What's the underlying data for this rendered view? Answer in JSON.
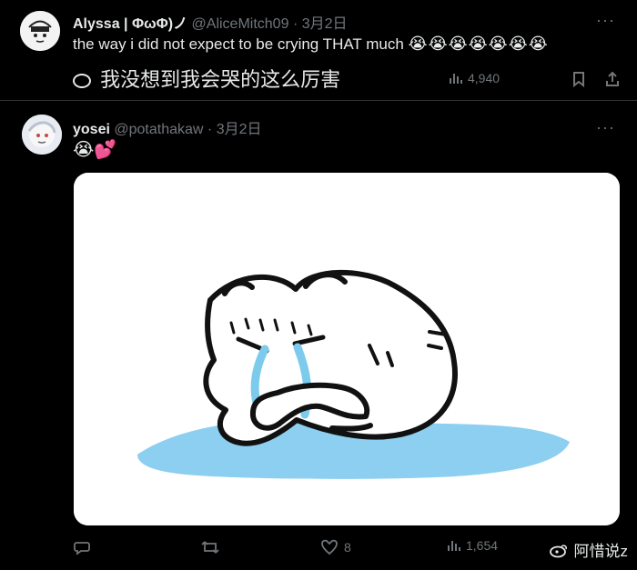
{
  "tweet1": {
    "display_name": "Alyssa | ΦωΦ)ノ",
    "handle": "@AliceMitch09",
    "separator": "·",
    "date": "3月2日",
    "text": "the way i did not expect to be crying THAT much",
    "emojis": "😭😭😭😭😭😭😭",
    "translation": "我没想到我会哭的这么厉害",
    "views": "4,940",
    "icons": [
      "more-icon",
      "views-icon",
      "bookmark-icon",
      "share-icon",
      "speech-bubble-icon"
    ]
  },
  "tweet2": {
    "display_name": "yosei",
    "handle": "@potathakaw",
    "separator": "·",
    "date": "3月2日",
    "emoji_text": "😭💕",
    "likes": "8",
    "views": "1,654",
    "icons": [
      "more-icon",
      "reply-icon",
      "retweet-icon",
      "heart-icon",
      "views-icon"
    ]
  },
  "watermark": {
    "text": "阿惜说z",
    "icon": "weibo-icon"
  },
  "colors": {
    "background": "#000000",
    "text": "#e7e9ea",
    "muted": "#71767b",
    "divider": "#2f3336",
    "puddle": "#8ccff0"
  }
}
